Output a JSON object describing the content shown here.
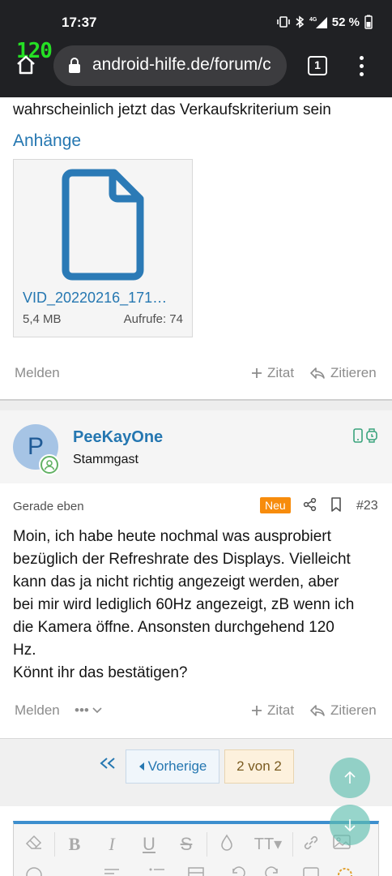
{
  "status_bar": {
    "time": "17:37",
    "battery": "52 %",
    "fps_counter": "120",
    "network": "4G"
  },
  "browser": {
    "url": "android-hilfe.de/forum/c",
    "tab_count": "1"
  },
  "post1": {
    "text_tail": "wahrscheinlich jetzt das Verkaufskriterium sein",
    "attachments_title": "Anhänge",
    "attachment": {
      "name": "VID_20220216_171…",
      "size": "5,4 MB",
      "views": "Aufrufe: 74"
    },
    "actions": {
      "report": "Melden",
      "quote": "Zitat",
      "reply": "Zitieren"
    }
  },
  "post2": {
    "avatar_letter": "P",
    "username": "PeeKayOne",
    "user_title": "Stammgast",
    "date": "Gerade eben",
    "badge": "Neu",
    "number": "#23",
    "body_lines": [
      "Moin, ich habe heute nochmal was ausprobiert",
      "bezüglich der Refreshrate des Displays. Vielleicht",
      "kann das ja nicht richtig angezeigt werden, aber",
      "bei mir wird lediglich 60Hz angezeigt, zB wenn ich",
      "die Kamera öffne. Ansonsten durchgehend 120",
      "Hz.",
      "Könnt ihr das bestätigen?"
    ],
    "actions": {
      "report": "Melden",
      "more": "•••",
      "quote": "Zitat",
      "reply": "Zitieren"
    }
  },
  "pagination": {
    "prev": "Vorherige",
    "current": "2 von 2"
  },
  "colors": {
    "link": "#2577b1",
    "badge_new": "#f78c0c",
    "chrome": "#202124",
    "fps": "#25e024"
  }
}
